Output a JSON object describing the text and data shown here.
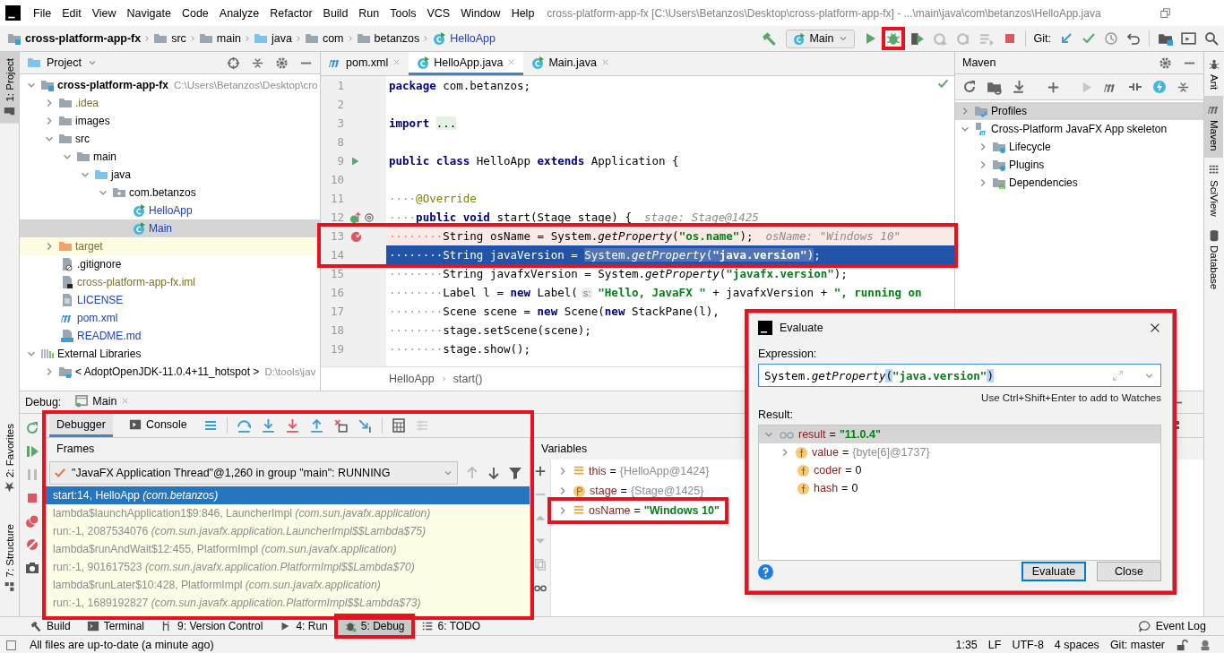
{
  "window": {
    "title": "cross-platform-app-fx [C:\\Users\\Betanzos\\Desktop\\cross-platform-app-fx] - ...\\main\\java\\com\\betanzos\\HelloApp.java"
  },
  "menu": [
    "File",
    "Edit",
    "View",
    "Navigate",
    "Code",
    "Analyze",
    "Refactor",
    "Build",
    "Run",
    "Tools",
    "VCS",
    "Window",
    "Help"
  ],
  "breadcrumbs": [
    {
      "label": "cross-platform-app-fx",
      "kind": "project"
    },
    {
      "label": "src",
      "kind": "folder"
    },
    {
      "label": "main",
      "kind": "folder"
    },
    {
      "label": "java",
      "kind": "source-folder"
    },
    {
      "label": "com",
      "kind": "folder"
    },
    {
      "label": "betanzos",
      "kind": "folder"
    },
    {
      "label": "HelloApp",
      "kind": "class"
    }
  ],
  "run_config": "Main",
  "git_label": "Git:",
  "left_strip": [
    {
      "label": "1: Project",
      "kind": "project",
      "selected": true
    },
    {
      "label": "2: Favorites",
      "kind": "favorites",
      "selected": false
    },
    {
      "label": "7: Structure",
      "kind": "structure",
      "selected": false
    }
  ],
  "right_strip": [
    {
      "label": "Ant",
      "kind": "ant",
      "selected": false
    },
    {
      "label": "Maven",
      "kind": "maven",
      "selected": true
    },
    {
      "label": "SciView",
      "kind": "sciview",
      "selected": false
    },
    {
      "label": "Database",
      "kind": "database",
      "selected": false
    }
  ],
  "project": {
    "title": "Project",
    "tree": [
      {
        "label": "cross-platform-app-fx",
        "path": "C:\\Users\\Betanzos\\Desktop\\cro",
        "kind": "project",
        "expanded": true,
        "selected": false,
        "children": [
          {
            "label": ".idea",
            "kind": "folder",
            "color": "#7d6e2e",
            "expanded": false,
            "selected": false
          },
          {
            "label": "images",
            "kind": "folder",
            "expanded": false,
            "selected": false
          },
          {
            "label": "src",
            "kind": "folder",
            "expanded": true,
            "selected": false,
            "children": [
              {
                "label": "main",
                "kind": "folder",
                "expanded": true,
                "selected": false,
                "children": [
                  {
                    "label": "java",
                    "kind": "source-folder",
                    "expanded": true,
                    "selected": false,
                    "children": [
                      {
                        "label": "com.betanzos",
                        "kind": "package",
                        "expanded": true,
                        "selected": false,
                        "children": [
                          {
                            "label": "HelloApp",
                            "kind": "class",
                            "color": "#2140b5",
                            "selected": false
                          },
                          {
                            "label": "Main",
                            "kind": "class",
                            "color": "#2140b5",
                            "selected": true
                          }
                        ]
                      }
                    ]
                  }
                ]
              }
            ]
          },
          {
            "label": "target",
            "kind": "excluded-folder",
            "color": "#7d6e2e",
            "expanded": false,
            "selected": false
          },
          {
            "label": ".gitignore",
            "kind": "ignore-file",
            "selected": false
          },
          {
            "label": "cross-platform-app-fx.iml",
            "kind": "module-file",
            "color": "#7d6e2e",
            "selected": false
          },
          {
            "label": "LICENSE",
            "kind": "text-file",
            "color": "#2140b5",
            "selected": false
          },
          {
            "label": "pom.xml",
            "kind": "maven-file",
            "color": "#2140b5",
            "selected": false
          },
          {
            "label": "README.md",
            "kind": "markdown-file",
            "color": "#2140b5",
            "selected": false
          }
        ]
      },
      {
        "label": "External Libraries",
        "kind": "libraries",
        "expanded": true,
        "selected": false,
        "children": [
          {
            "label": "< AdoptOpenJDK-11.0.4+11_hotspot >",
            "path": "D:\\tools\\jav",
            "kind": "jdk",
            "expanded": false,
            "selected": false
          }
        ]
      }
    ]
  },
  "editor": {
    "tabs": [
      {
        "label": "pom.xml",
        "kind": "maven-file",
        "selected": false
      },
      {
        "label": "HelloApp.java",
        "kind": "class",
        "selected": true
      },
      {
        "label": "Main.java",
        "kind": "class",
        "selected": false
      }
    ],
    "lines": [
      {
        "number": "1",
        "breakpoint": false,
        "current": false,
        "segments": [
          {
            "text": "package",
            "kind": "keyword"
          },
          {
            "text": " com.betanzos;",
            "kind": "plain"
          }
        ]
      },
      {
        "number": "2",
        "breakpoint": false,
        "current": false
      },
      {
        "number": "3",
        "breakpoint": false,
        "current": false,
        "segments": [
          {
            "text": "import ",
            "kind": "keyword"
          },
          {
            "text": "...",
            "kind": "fold"
          }
        ]
      },
      {
        "number": "8",
        "breakpoint": false,
        "current": false
      },
      {
        "number": "9",
        "gutter_icons": [
          {
            "kind": "run"
          }
        ],
        "breakpoint": false,
        "current": false,
        "segments": [
          {
            "text": "public class",
            "kind": "keyword"
          },
          {
            "text": " HelloApp ",
            "kind": "plain"
          },
          {
            "text": "extends",
            "kind": "keyword"
          },
          {
            "text": " Application {",
            "kind": "plain"
          }
        ]
      },
      {
        "number": "10",
        "breakpoint": false,
        "current": false
      },
      {
        "number": "11",
        "breakpoint": false,
        "current": false,
        "segments": [
          {
            "text": "····",
            "kind": "ws"
          },
          {
            "text": "@Override",
            "kind": "annotation"
          }
        ]
      },
      {
        "number": "12",
        "gutter_icons": [
          {
            "kind": "override"
          },
          {
            "kind": "annotation"
          }
        ],
        "breakpoint": false,
        "current": false,
        "hint": "stage: Stage@1425",
        "segments": [
          {
            "text": "····",
            "kind": "ws"
          },
          {
            "text": "public void",
            "kind": "keyword"
          },
          {
            "text": " start(Stage stage) {",
            "kind": "plain"
          }
        ]
      },
      {
        "number": "13",
        "breakpoint": true,
        "current": false,
        "hint": "osName: \"Windows 10\"",
        "segments": [
          {
            "text": "········",
            "kind": "ws"
          },
          {
            "text": "String osName = System.",
            "kind": "plain"
          },
          {
            "text": "getProperty",
            "kind": "method"
          },
          {
            "text": "(",
            "kind": "plain"
          },
          {
            "text": "\"os.name\"",
            "kind": "string"
          },
          {
            "text": ");",
            "kind": "plain"
          }
        ]
      },
      {
        "number": "14",
        "breakpoint": false,
        "current": true,
        "segments": [
          {
            "text": "········",
            "kind": "ws",
            "selected": false
          },
          {
            "text": "String javaVersion = ",
            "kind": "plain",
            "selected": false
          },
          {
            "text": "System.",
            "kind": "plain",
            "selected": true
          },
          {
            "text": "getProperty",
            "kind": "method",
            "selected": true
          },
          {
            "text": "(",
            "kind": "plain",
            "selected": true
          },
          {
            "text": "\"java.version\"",
            "kind": "string",
            "selected": true
          },
          {
            "text": ")",
            "kind": "plain",
            "selected": true
          },
          {
            "text": ";",
            "kind": "plain",
            "selected": false
          }
        ]
      },
      {
        "number": "15",
        "breakpoint": false,
        "current": false,
        "segments": [
          {
            "text": "········",
            "kind": "ws"
          },
          {
            "text": "String javafxVersion = System.",
            "kind": "plain"
          },
          {
            "text": "getProperty",
            "kind": "method"
          },
          {
            "text": "(",
            "kind": "plain"
          },
          {
            "text": "\"javafx.version\"",
            "kind": "string"
          },
          {
            "text": ");",
            "kind": "plain"
          }
        ]
      },
      {
        "number": "16",
        "breakpoint": false,
        "current": false,
        "segments": [
          {
            "text": "········",
            "kind": "ws"
          },
          {
            "text": "Label l = ",
            "kind": "plain"
          },
          {
            "text": "new",
            "kind": "keyword"
          },
          {
            "text": " Label(",
            "kind": "plain"
          },
          {
            "text": "s:",
            "kind": "param-hint"
          },
          {
            "text": "\"Hello, JavaFX \"",
            "kind": "string"
          },
          {
            "text": " + javafxVersion + ",
            "kind": "plain"
          },
          {
            "text": "\", running on",
            "kind": "string"
          }
        ]
      },
      {
        "number": "17",
        "breakpoint": false,
        "current": false,
        "segments": [
          {
            "text": "········",
            "kind": "ws"
          },
          {
            "text": "Scene scene = ",
            "kind": "plain"
          },
          {
            "text": "new",
            "kind": "keyword"
          },
          {
            "text": " Scene(",
            "kind": "plain"
          },
          {
            "text": "new",
            "kind": "keyword"
          },
          {
            "text": " StackPane(l),",
            "kind": "plain"
          }
        ]
      },
      {
        "number": "18",
        "breakpoint": false,
        "current": false,
        "segments": [
          {
            "text": "········",
            "kind": "ws"
          },
          {
            "text": "stage.setScene(scene);",
            "kind": "plain"
          }
        ]
      },
      {
        "number": "19",
        "breakpoint": false,
        "current": false,
        "segments": [
          {
            "text": "········",
            "kind": "ws"
          },
          {
            "text": "stage.show();",
            "kind": "plain"
          }
        ]
      }
    ],
    "breadcrumbs": [
      "HelloApp",
      "start()"
    ]
  },
  "maven": {
    "title": "Maven",
    "tree": [
      {
        "label": "Profiles",
        "kind": "profiles",
        "expanded": false,
        "selected": true
      },
      {
        "label": "Cross-Platform JavaFX App skeleton",
        "kind": "maven-project",
        "expanded": true,
        "selected": false,
        "children": [
          {
            "label": "Lifecycle",
            "kind": "lifecycle",
            "expanded": false,
            "selected": false
          },
          {
            "label": "Plugins",
            "kind": "plugins",
            "expanded": false,
            "selected": false
          },
          {
            "label": "Dependencies",
            "kind": "dependencies",
            "expanded": false,
            "selected": false
          }
        ]
      }
    ]
  },
  "debug": {
    "title": "Debug:",
    "session": "Main",
    "tabs": [
      {
        "label": "Debugger",
        "kind": "debugger",
        "selected": true
      },
      {
        "label": "Console",
        "kind": "console",
        "selected": false
      }
    ],
    "frames_title": "Frames",
    "thread": "\"JavaFX Application Thread\"@1,260 in group \"main\": RUNNING",
    "frames": [
      {
        "text": "start:14, HelloApp *(com.betanzos)*",
        "selected": true
      },
      {
        "text": "lambda$launchApplication1$9:846, LauncherImpl *(com.sun.javafx.application)*",
        "selected": false
      },
      {
        "text": "run:-1, 2087534076 *(com.sun.javafx.application.LauncherImpl$$Lambda$75)*",
        "selected": false
      },
      {
        "text": "lambda$runAndWait$12:455, PlatformImpl *(com.sun.javafx.application)*",
        "selected": false
      },
      {
        "text": "run:-1, 901617523 *(com.sun.javafx.application.PlatformImpl$$Lambda$70)*",
        "selected": false
      },
      {
        "text": "lambda$runLater$10:428, PlatformImpl *(com.sun.javafx.application)*",
        "selected": false
      },
      {
        "text": "run:-1, 1689192827 *(com.sun.javafx.application.PlatformImpl$$Lambda$73)*",
        "selected": false
      }
    ],
    "variables_title": "Variables",
    "variables": [
      {
        "name": "this",
        "equals": "=",
        "value": {
          "text": "{HelloApp@1424}",
          "kind": "object"
        },
        "kind": "field",
        "expanded": false
      },
      {
        "name": "stage",
        "equals": "=",
        "value": {
          "text": "{Stage@1425}",
          "kind": "object"
        },
        "kind": "param",
        "expanded": false
      },
      {
        "name": "osName",
        "equals": "=",
        "value": {
          "text": "\"Windows 10\"",
          "kind": "string"
        },
        "kind": "field",
        "expanded": false
      }
    ]
  },
  "tool_windows": [
    {
      "label": "Build",
      "kind": "build",
      "selected": false
    },
    {
      "label": "Terminal",
      "kind": "terminal",
      "selected": false
    },
    {
      "label": "9: Version Control",
      "kind": "vcs",
      "selected": false
    },
    {
      "label": "4: Run",
      "kind": "run",
      "selected": false
    },
    {
      "label": "5: Debug",
      "kind": "debug",
      "selected": true
    },
    {
      "label": "6: TODO",
      "kind": "todo",
      "selected": false
    }
  ],
  "event_log": "Event Log",
  "status": {
    "message": "All files are up-to-date (a minute ago)",
    "items": [
      "1:35",
      "LF",
      "UTF-8",
      "4 spaces",
      "Git: master"
    ]
  },
  "evaluate": {
    "title": "Evaluate",
    "expression_label": "Expression:",
    "expression": [
      {
        "text": "System.",
        "kind": "plain"
      },
      {
        "text": "getProperty",
        "kind": "method"
      },
      {
        "text": "(",
        "kind": "brace"
      },
      {
        "text": "\"java.version\"",
        "kind": "string"
      },
      {
        "text": ")",
        "kind": "brace"
      }
    ],
    "hint": "Use Ctrl+Shift+Enter to add to Watches",
    "result_label": "Result:",
    "result": [
      {
        "name": "result",
        "equals": "=",
        "value": {
          "text": "\"11.0.4\"",
          "kind": "string"
        },
        "kind": "watch",
        "expanded": true,
        "selected": true,
        "children": [
          {
            "name": "value",
            "equals": "=",
            "value": {
              "text": "{byte[6]@1737}",
              "kind": "object"
            },
            "kind": "field",
            "expanded": false,
            "selected": false
          },
          {
            "name": "coder",
            "equals": "=",
            "value": {
              "text": "0",
              "kind": "number"
            },
            "kind": "field",
            "selected": false
          },
          {
            "name": "hash",
            "equals": "=",
            "value": {
              "text": "0",
              "kind": "number"
            },
            "kind": "field",
            "selected": false
          }
        ]
      }
    ],
    "buttons": [
      {
        "label": "Evaluate",
        "kind": "default"
      },
      {
        "label": "Close",
        "kind": "normal"
      }
    ]
  }
}
